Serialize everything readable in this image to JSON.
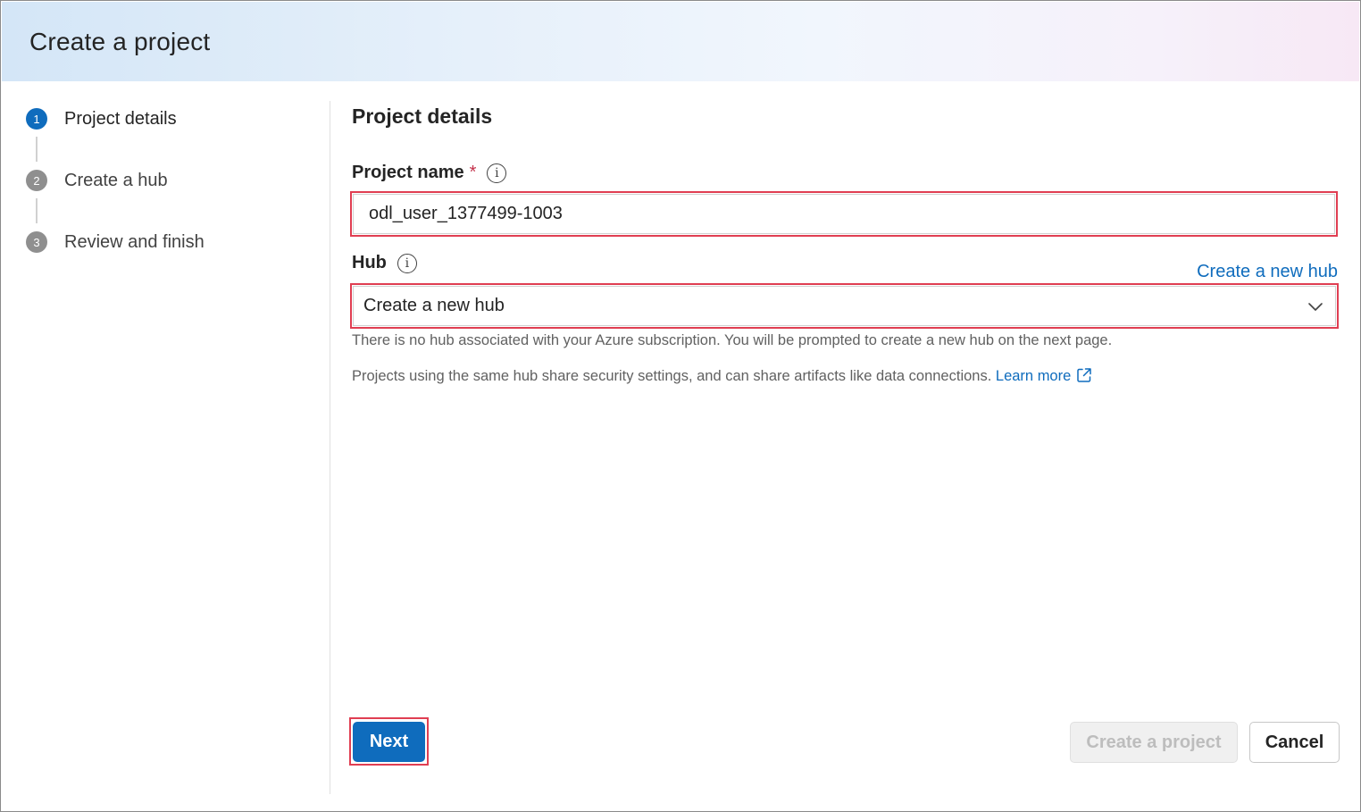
{
  "dialog": {
    "title": "Create a project"
  },
  "steps": [
    {
      "number": "1",
      "label": "Project details",
      "active": true
    },
    {
      "number": "2",
      "label": "Create a hub",
      "active": false
    },
    {
      "number": "3",
      "label": "Review and finish",
      "active": false
    }
  ],
  "form": {
    "section_title": "Project details",
    "project_name": {
      "label": "Project name",
      "required_mark": "*",
      "info_icon": "info-icon",
      "value": "odl_user_1377499-1003"
    },
    "hub": {
      "label": "Hub",
      "info_icon": "info-icon",
      "create_link": "Create a new hub",
      "selected": "Create a new hub",
      "note": "There is no hub associated with your Azure subscription. You will be prompted to create a new hub on the next page."
    },
    "help_text": "Projects using the same hub share security settings, and can share artifacts like data connections.",
    "learn_more": "Learn more"
  },
  "footer": {
    "next": "Next",
    "create_project": "Create a project",
    "cancel": "Cancel"
  },
  "colors": {
    "accent": "#0f6cbd",
    "highlight": "#e03e52",
    "required": "#c4314b"
  }
}
